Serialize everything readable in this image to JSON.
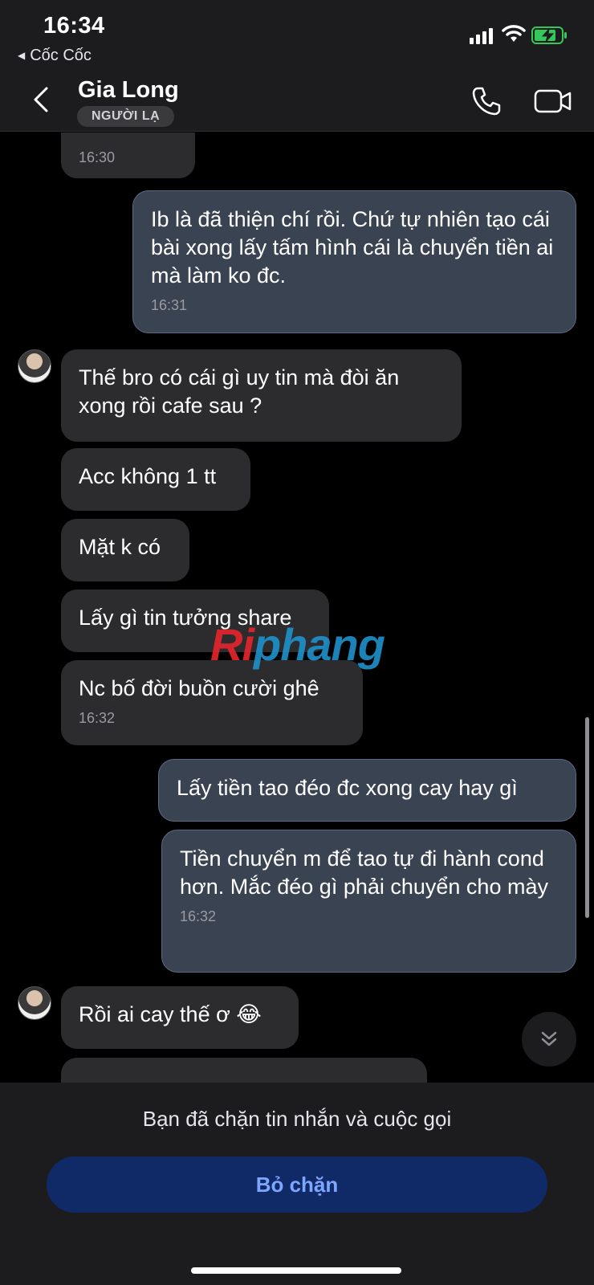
{
  "status_bar": {
    "time": "16:34",
    "back_app": "Cốc Cốc",
    "icons": [
      "signal-icon",
      "wifi-icon",
      "battery-charging-icon"
    ]
  },
  "header": {
    "name": "Gia Long",
    "badge": "NGƯỜI LẠ",
    "icons": [
      "chevron-left-icon",
      "phone-icon",
      "video-camera-icon"
    ]
  },
  "messages": [
    {
      "side": "in",
      "text": "",
      "time": "16:30"
    },
    {
      "side": "out",
      "text": "Ib là đã thiện chí rồi. Chứ tự nhiên tạo cái bài xong lấy tấm hình cái là chuyển tiền ai mà làm ko đc.",
      "time": "16:31"
    },
    {
      "side": "in",
      "text": "Thế bro có cái gì uy tin mà đòi ăn xong rồi cafe sau ?",
      "time": ""
    },
    {
      "side": "in",
      "text": "Acc không 1 tt",
      "time": ""
    },
    {
      "side": "in",
      "text": "Mặt k có",
      "time": ""
    },
    {
      "side": "in",
      "text": "Lấy gì tin tưởng share",
      "time": ""
    },
    {
      "side": "in",
      "text": "Nc bố đời buồn cười ghê",
      "time": "16:32"
    },
    {
      "side": "out",
      "text": "Lấy tiền tao đéo đc xong cay hay gì",
      "time": ""
    },
    {
      "side": "out",
      "text": "Tiền chuyển m để tao tự đi hành cond hơn. Mắc đéo gì phải chuyển cho mày",
      "time": "16:32"
    },
    {
      "side": "in",
      "text": "Rồi ai cay thế ơ 😂",
      "time": ""
    }
  ],
  "watermark": {
    "part1": "Ri",
    "part2": "phang"
  },
  "footer": {
    "blocked_text": "Bạn đã chặn tin nhắn và cuộc gọi",
    "unblock_label": "Bỏ chặn"
  },
  "colors": {
    "background": "#000000",
    "incoming_bubble": "#2c2c2e",
    "outgoing_bubble": "#3a4352",
    "unblock_button": "#0f2a66",
    "unblock_text": "#7fa6ff"
  }
}
